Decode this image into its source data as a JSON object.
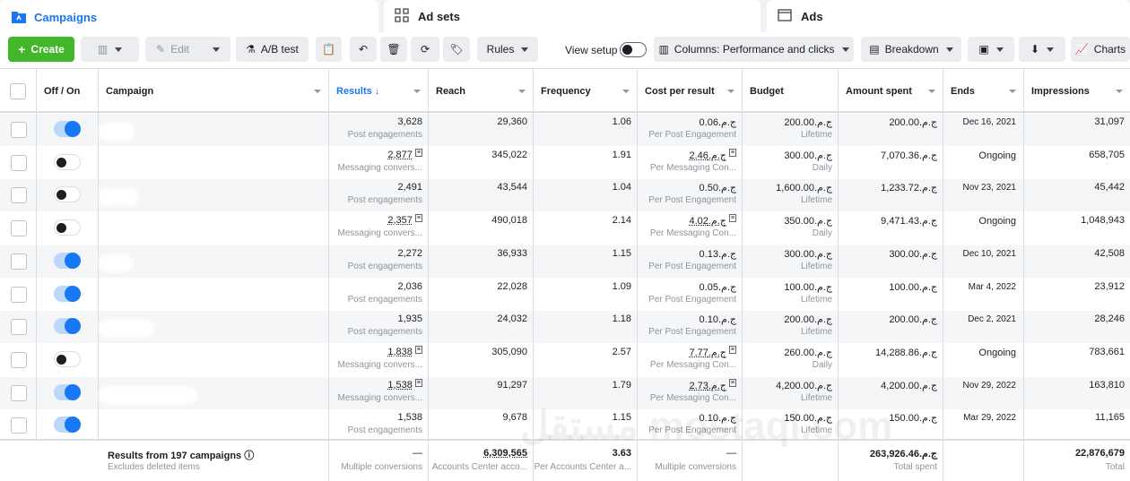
{
  "tabs": [
    {
      "label": "Campaigns",
      "icon": "folder-icon"
    },
    {
      "label": "Ad sets",
      "icon": "grid-icon"
    },
    {
      "label": "Ads",
      "icon": "ad-icon"
    }
  ],
  "toolbar": {
    "create": "Create",
    "edit": "Edit",
    "ab_test": "A/B test",
    "rules": "Rules",
    "view_setup": "View setup",
    "columns": "Columns: Performance and clicks",
    "breakdown": "Breakdown",
    "charts": "Charts"
  },
  "columns": {
    "off_on": "Off / On",
    "campaign": "Campaign",
    "results": "Results ↓",
    "reach": "Reach",
    "frequency": "Frequency",
    "cost_per_result": "Cost per result",
    "budget": "Budget",
    "amount_spent": "Amount spent",
    "ends": "Ends",
    "impressions": "Impressions"
  },
  "rows": [
    {
      "on": true,
      "blur_w": 40,
      "results": "3,628",
      "results_sub": "Post engagements",
      "results_u": false,
      "reach": "29,360",
      "freq": "1.06",
      "cost": "ج.م.‏0.06",
      "cost_sub": "Per Post Engagement",
      "cost_u": false,
      "budget": "ج.م.‏200.00",
      "budget_sub": "Lifetime",
      "spent": "ج.م.‏200.00",
      "ends": "Dec 16, 2021",
      "ends_date": true,
      "impr": "31,097"
    },
    {
      "on": false,
      "blur_w": 0,
      "results": "2,877",
      "results_sub": "Messaging convers...",
      "results_u": true,
      "reach": "345,022",
      "freq": "1.91",
      "cost": "ج.م.‏2.46",
      "cost_sub": "Per Messaging Con...",
      "cost_u": true,
      "budget": "ج.م.‏300.00",
      "budget_sub": "Daily",
      "spent": "ج.م.‏7,070.36",
      "ends": "Ongoing",
      "ends_date": false,
      "impr": "658,705"
    },
    {
      "on": false,
      "blur_w": 45,
      "results": "2,491",
      "results_sub": "Post engagements",
      "results_u": false,
      "reach": "43,544",
      "freq": "1.04",
      "cost": "ج.م.‏0.50",
      "cost_sub": "Per Post Engagement",
      "cost_u": false,
      "budget": "ج.م.‏1,600.00",
      "budget_sub": "Lifetime",
      "spent": "ج.م.‏1,233.72",
      "ends": "Nov 23, 2021",
      "ends_date": true,
      "impr": "45,442"
    },
    {
      "on": false,
      "blur_w": 0,
      "results": "2,357",
      "results_sub": "Messaging convers...",
      "results_u": true,
      "reach": "490,018",
      "freq": "2.14",
      "cost": "ج.م.‏4.02",
      "cost_sub": "Per Messaging Con...",
      "cost_u": true,
      "budget": "ج.م.‏350.00",
      "budget_sub": "Daily",
      "spent": "ج.م.‏9,471.43",
      "ends": "Ongoing",
      "ends_date": false,
      "impr": "1,048,943"
    },
    {
      "on": true,
      "blur_w": 38,
      "results": "2,272",
      "results_sub": "Post engagements",
      "results_u": false,
      "reach": "36,933",
      "freq": "1.15",
      "cost": "ج.م.‏0.13",
      "cost_sub": "Per Post Engagement",
      "cost_u": false,
      "budget": "ج.م.‏300.00",
      "budget_sub": "Lifetime",
      "spent": "ج.م.‏300.00",
      "ends": "Dec 10, 2021",
      "ends_date": true,
      "impr": "42,508"
    },
    {
      "on": true,
      "blur_w": 0,
      "results": "2,036",
      "results_sub": "Post engagements",
      "results_u": false,
      "reach": "22,028",
      "freq": "1.09",
      "cost": "ج.م.‏0.05",
      "cost_sub": "Per Post Engagement",
      "cost_u": false,
      "budget": "ج.م.‏100.00",
      "budget_sub": "Lifetime",
      "spent": "ج.م.‏100.00",
      "ends": "Mar 4, 2022",
      "ends_date": true,
      "impr": "23,912"
    },
    {
      "on": true,
      "blur_w": 62,
      "results": "1,935",
      "results_sub": "Post engagements",
      "results_u": false,
      "reach": "24,032",
      "freq": "1.18",
      "cost": "ج.م.‏0.10",
      "cost_sub": "Per Post Engagement",
      "cost_u": false,
      "budget": "ج.م.‏200.00",
      "budget_sub": "Lifetime",
      "spent": "ج.م.‏200.00",
      "ends": "Dec 2, 2021",
      "ends_date": true,
      "impr": "28,246"
    },
    {
      "on": false,
      "blur_w": 0,
      "results": "1,838",
      "results_sub": "Messaging convers...",
      "results_u": true,
      "reach": "305,090",
      "freq": "2.57",
      "cost": "ج.م.‏7.77",
      "cost_sub": "Per Messaging Con...",
      "cost_u": true,
      "budget": "ج.م.‏260.00",
      "budget_sub": "Daily",
      "spent": "ج.م.‏14,288.86",
      "ends": "Ongoing",
      "ends_date": false,
      "impr": "783,661"
    },
    {
      "on": true,
      "blur_w": 110,
      "results": "1,538",
      "results_sub": "Messaging convers...",
      "results_u": true,
      "reach": "91,297",
      "freq": "1.79",
      "cost": "ج.م.‏2.73",
      "cost_sub": "Per Messaging Con...",
      "cost_u": true,
      "budget": "ج.م.‏4,200.00",
      "budget_sub": "Lifetime",
      "spent": "ج.م.‏4,200.00",
      "ends": "Nov 29, 2022",
      "ends_date": true,
      "impr": "163,810"
    },
    {
      "on": true,
      "blur_w": 0,
      "results": "1,538",
      "results_sub": "Post engagements",
      "results_u": false,
      "reach": "9,678",
      "freq": "1.15",
      "cost": "ج.م.‏0.10",
      "cost_sub": "Per Post Engagement",
      "cost_u": false,
      "budget": "ج.م.‏150.00",
      "budget_sub": "Lifetime",
      "spent": "ج.م.‏150.00",
      "ends": "Mar 29, 2022",
      "ends_date": true,
      "impr": "11,165"
    }
  ],
  "footer": {
    "title": "Results from 197 campaigns",
    "subtitle": "Excludes deleted items",
    "results": "—",
    "results_sub": "Multiple conversions",
    "reach": "6,309,565",
    "reach_sub": "Accounts Center acco...",
    "freq": "3.63",
    "freq_sub": "Per Accounts Center a...",
    "cost": "—",
    "cost_sub": "Multiple conversions",
    "spent": "ج.م.‏263,926.46",
    "spent_sub": "Total spent",
    "impr": "22,876,679",
    "impr_sub": "Total"
  },
  "watermark": "مستقل mostaql.com",
  "colors": {
    "accent": "#1877f2",
    "create": "#42b72a"
  }
}
